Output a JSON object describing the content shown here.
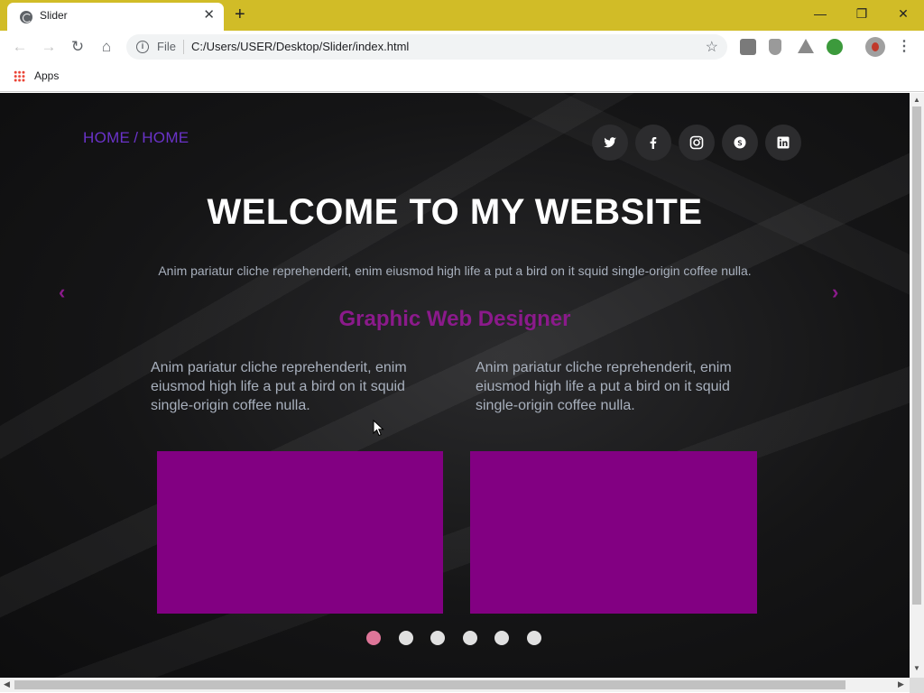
{
  "browser": {
    "tab_title": "Slider",
    "tab_close": "✕",
    "new_tab": "+",
    "window_controls": {
      "minimize": "—",
      "restore": "❐",
      "close": "✕"
    },
    "nav": {
      "back": "←",
      "forward": "→",
      "reload": "↻",
      "home": "⌂"
    },
    "address": {
      "info": "i",
      "scheme": "File",
      "url": "C:/Users/USER/Desktop/Slider/index.html",
      "star": "☆"
    },
    "extensions": [
      {
        "name": "fb-extension-icon",
        "color": "#7a7a7a"
      },
      {
        "name": "shield-extension-icon",
        "color": "#9a9a9a"
      },
      {
        "name": "drive-extension-icon",
        "color": "#8a8a8a"
      },
      {
        "name": "globe-extension-icon",
        "color": "#3c9a3c"
      }
    ],
    "menu": "⋮",
    "bookmarks": {
      "apps_label": "Apps"
    }
  },
  "page": {
    "breadcrumb": {
      "first": "HOME",
      "separator": "/",
      "second": "HOME"
    },
    "social": [
      "twitter-icon",
      "facebook-icon",
      "instagram-icon",
      "skype-icon",
      "linkedin-icon"
    ],
    "headline": "WELCOME TO MY WEBSITE",
    "intro": "Anim pariatur cliche reprehenderit, enim eiusmod high life a put a bird on it squid single-origin coffee nulla.",
    "arrows": {
      "prev": "‹",
      "next": "›"
    },
    "subhead": "Graphic Web Designer",
    "columns": [
      {
        "text": "Anim pariatur cliche reprehenderit, enim eiusmod high life a put a bird on it squid single-origin coffee nulla."
      },
      {
        "text": "Anim pariatur cliche reprehenderit, enim eiusmod high life a put a bird on it squid single-origin coffee nulla."
      }
    ],
    "slider": {
      "total": 6,
      "active_index": 0
    },
    "colors": {
      "accent_purple": "#6a33c9",
      "magenta": "#8b1a8b",
      "media_fill": "#820082",
      "active_dot": "#de7598",
      "titlebar": "#d1bc27"
    }
  }
}
